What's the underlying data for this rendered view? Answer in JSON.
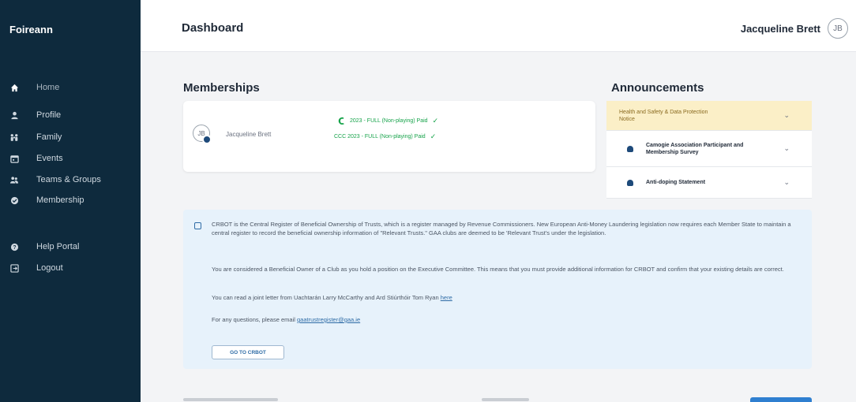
{
  "app": {
    "brand": "Foireann"
  },
  "sidebar": {
    "items": [
      {
        "label": "Home",
        "icon": "home-icon",
        "active": true
      },
      {
        "label": "Profile",
        "icon": "user-icon"
      },
      {
        "label": "Family",
        "icon": "family-icon"
      },
      {
        "label": "Events",
        "icon": "calendar-icon"
      },
      {
        "label": "Teams & Groups",
        "icon": "group-icon"
      },
      {
        "label": "Membership",
        "icon": "membership-icon"
      },
      {
        "label": "Help Portal",
        "icon": "help-icon"
      },
      {
        "label": "Logout",
        "icon": "logout-icon"
      }
    ]
  },
  "header": {
    "title": "Dashboard",
    "user_name": "Jacqueline Brett",
    "user_initials": "JB"
  },
  "memberships": {
    "title": "Memberships",
    "member_name": "Jacqueline Brett",
    "member_initials": "JB",
    "tags": [
      "2023 - FULL (Non-playing) Paid",
      "CCC 2023 - FULL (Non-playing) Paid"
    ]
  },
  "announcements": {
    "title": "Announcements",
    "items": [
      {
        "title": "Health and Safety & Data Protection Notice"
      },
      {
        "title": "Camogie Association Participant and Membership Survey"
      },
      {
        "title": "Anti-doping Statement"
      }
    ]
  },
  "crbot": {
    "p1": "CRBOT is the Central Register of Beneficial Ownership of Trusts, which is a register managed by Revenue Commissioners. New European Anti-Money Laundering legislation now requires each Member State to maintain a central register to record the beneficial ownership information of \"Relevant Trusts.\" GAA clubs are deemed to be 'Relevant Trust's under the legislation.",
    "p2": "You are considered a Beneficial Owner of a Club as you hold a position on the Executive Committee. This means that you must provide additional information for CRBOT and confirm that your existing details are correct.",
    "p3_text": "You can read a joint letter from Uachtarán Larry McCarthy and Ard Stiúrthóir Tom Ryan ",
    "p3_link": "here",
    "p4_text": "For any questions, please email ",
    "p4_link": "gaatrustregister@gaa.ie",
    "button": "GO TO CRBOT"
  }
}
